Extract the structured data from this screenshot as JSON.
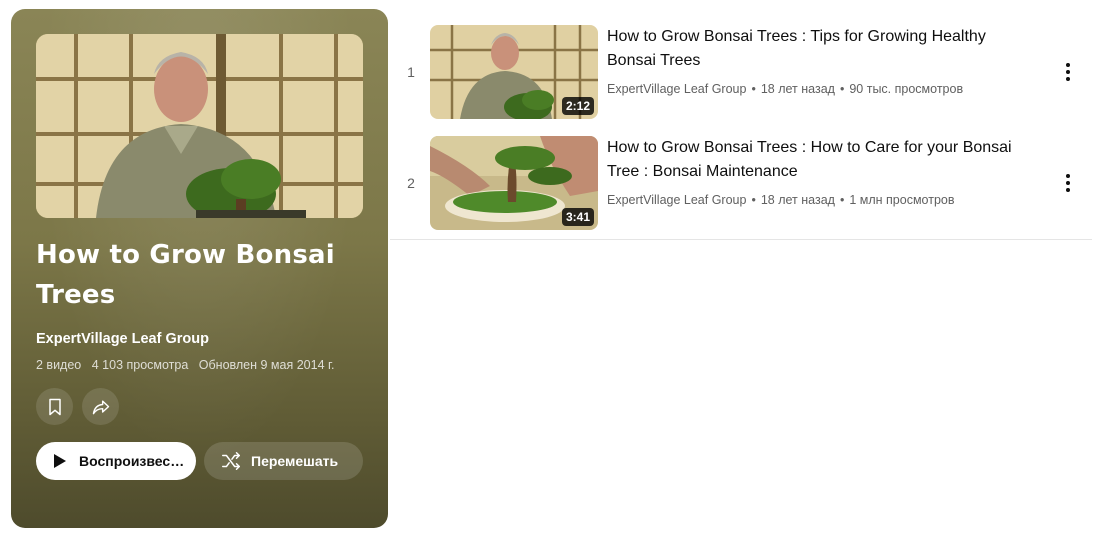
{
  "playlist": {
    "title": "How to Grow Bonsai Trees",
    "owner": "ExpertVillage Leaf Group",
    "video_count": "2 видео",
    "views": "4 103 просмотра",
    "updated": "Обновлен 9 мая 2014 г.",
    "play_label": "Воспроизвес…",
    "shuffle_label": "Перемешать"
  },
  "videos": [
    {
      "index": "1",
      "title": "How to Grow Bonsai Trees : Tips for Growing Healthy Bonsai Trees",
      "channel": "ExpertVillage Leaf Group",
      "age": "18 лет назад",
      "views": "90 тыс. просмотров",
      "duration": "2:12"
    },
    {
      "index": "2",
      "title": "How to Grow Bonsai Trees : How to Care for your Bonsai Tree : Bonsai Maintenance",
      "channel": "ExpertVillage Leaf Group",
      "age": "18 лет назад",
      "views": "1 млн просмотров",
      "duration": "3:41"
    }
  ],
  "colors": {
    "card_bg": "#7c7748",
    "text_primary": "#0f0f0f",
    "text_secondary": "#606060"
  }
}
